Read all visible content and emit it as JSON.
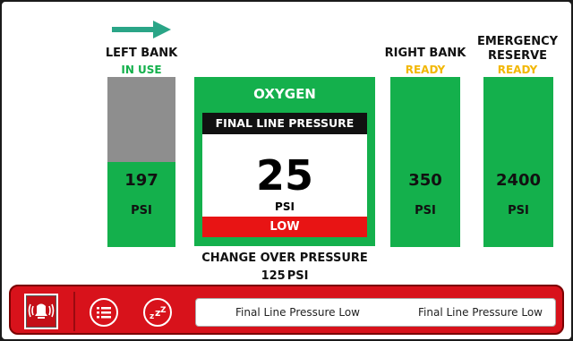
{
  "header": {
    "left_bank_label": "LEFT BANK",
    "left_bank_status": "IN USE",
    "right_bank_label": "RIGHT BANK",
    "right_bank_status": "READY",
    "reserve_label_line1": "EMERGENCY",
    "reserve_label_line2": "RESERVE",
    "reserve_status": "READY"
  },
  "left_bank": {
    "value": "197",
    "unit": "PSI",
    "fill_fraction": 0.5
  },
  "right_bank": {
    "value": "350",
    "unit": "PSI"
  },
  "reserve": {
    "value": "2400",
    "unit": "PSI"
  },
  "oxygen": {
    "title": "OXYGEN",
    "final_line_label": "FINAL LINE PRESSURE",
    "value": "25",
    "unit": "PSI",
    "alarm": "LOW"
  },
  "changeover": {
    "label": "CHANGE OVER PRESSURE",
    "value": "125",
    "unit": "PSI"
  },
  "alarm_bar": {
    "message_1": "Final Line Pressure Low",
    "message_2": "Final Line Pressure Low"
  },
  "colors": {
    "green": "#14b04c",
    "status_green": "#14b04c",
    "status_yellow": "#f2b705",
    "alarm_red": "#e81414",
    "arrow_teal": "#2aa587"
  },
  "icons": [
    "direction-arrow-icon",
    "alarm-bell-icon",
    "menu-list-icon",
    "snooze-icon"
  ]
}
